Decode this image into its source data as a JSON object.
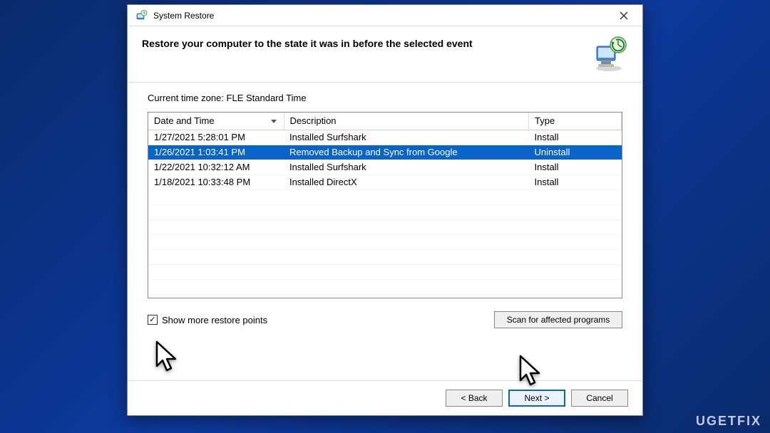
{
  "window": {
    "title": "System Restore"
  },
  "header": {
    "heading": "Restore your computer to the state it was in before the selected event"
  },
  "timezone_line": "Current time zone: FLE Standard Time",
  "columns": {
    "date": "Date and Time",
    "desc": "Description",
    "type": "Type"
  },
  "rows": [
    {
      "date": "1/27/2021 5:28:01 PM",
      "desc": "Installed Surfshark",
      "type": "Install",
      "selected": false
    },
    {
      "date": "1/26/2021 1:03:41 PM",
      "desc": "Removed Backup and Sync from Google",
      "type": "Uninstall",
      "selected": true
    },
    {
      "date": "1/22/2021 10:32:12 AM",
      "desc": "Installed Surfshark",
      "type": "Install",
      "selected": false
    },
    {
      "date": "1/18/2021 10:33:48 PM",
      "desc": "Installed DirectX",
      "type": "Install",
      "selected": false
    }
  ],
  "checkbox": {
    "checked": true,
    "label": "Show more restore points"
  },
  "buttons": {
    "scan": "Scan for affected programs",
    "back": "< Back",
    "next": "Next >",
    "cancel": "Cancel"
  },
  "watermark": "UGETFIX"
}
